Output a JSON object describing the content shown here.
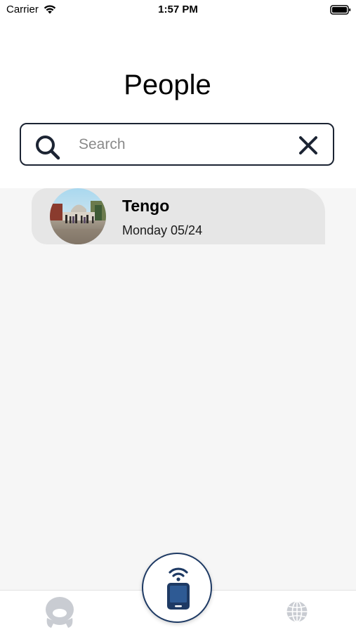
{
  "status_bar": {
    "carrier": "Carrier",
    "time": "1:57 PM"
  },
  "header": {
    "title": "People"
  },
  "search": {
    "placeholder": "Search",
    "value": ""
  },
  "contacts": [
    {
      "name": "Tengo",
      "date": "Monday 05/24"
    }
  ],
  "tab_bar": {
    "items": [
      {
        "icon": "profile-icon"
      },
      {
        "icon": "phone-signal-icon"
      },
      {
        "icon": "globe-icon"
      }
    ]
  },
  "colors": {
    "accent": "#1e3a64",
    "list_background": "#f6f6f6",
    "row_background": "#e6e6e6",
    "search_border": "#1c2433",
    "inactive_icon": "#c9ccd2"
  }
}
